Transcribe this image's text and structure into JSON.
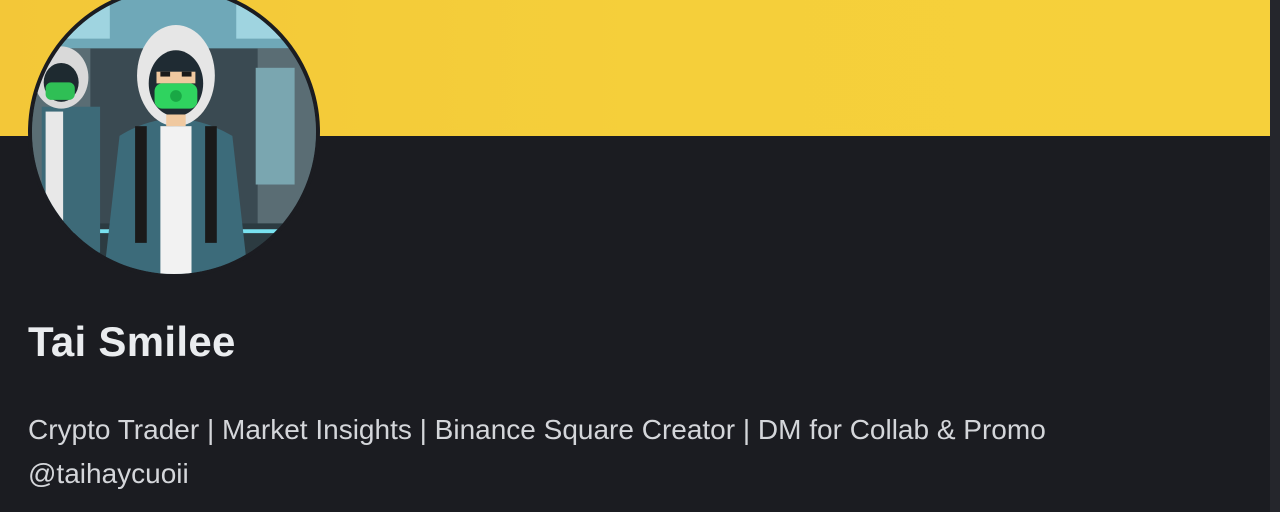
{
  "profile": {
    "display_name": "Tai Smilee",
    "bio_line_1": "Crypto Trader | Market Insights | Binance Square Creator | DM for Collab & Promo",
    "bio_line_2": "@taihaycuoii"
  },
  "colors": {
    "banner": "#f3c738",
    "background": "#1b1c21",
    "name_text": "#eaecef",
    "bio_text": "#d4d6da"
  },
  "icons": {
    "avatar": "avatar-hooded-character"
  }
}
